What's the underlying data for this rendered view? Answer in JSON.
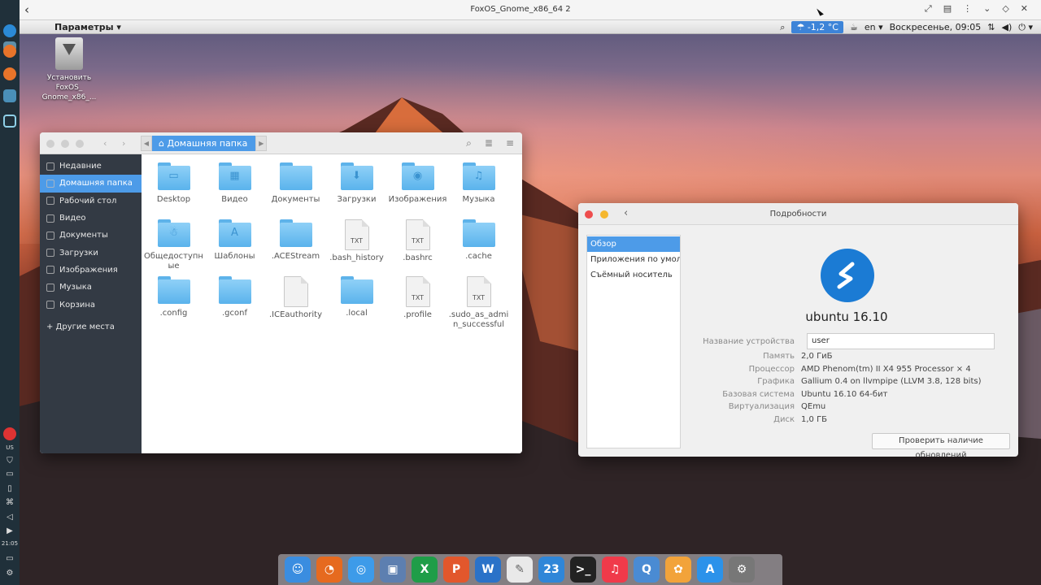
{
  "host": {
    "title": "FoxOS_Gnome_x86_64 2",
    "back_glyph": "‹",
    "icons": [
      "fullscreen-icon",
      "keyboard-icon",
      "more-icon",
      "chevron-down-icon",
      "diamond-icon",
      "close-icon"
    ]
  },
  "left_dock": {
    "lang": "US",
    "time": "21:05"
  },
  "top_panel": {
    "menu_label": "Параметры ▾",
    "weather": "☂ -1,2 °C",
    "lang": "en ▾",
    "clock": "Воскресенье, 09:05"
  },
  "desktop_icon": {
    "label": "Установить FoxOS_ Gnome_x86_..."
  },
  "files_window": {
    "breadcrumb": "Домашняя папка",
    "sidebar": [
      {
        "label": "Недавние",
        "icon": "clock-icon"
      },
      {
        "label": "Домашняя папка",
        "icon": "home-icon",
        "active": true
      },
      {
        "label": "Рабочий стол",
        "icon": "desktop-icon"
      },
      {
        "label": "Видео",
        "icon": "video-icon"
      },
      {
        "label": "Документы",
        "icon": "document-icon"
      },
      {
        "label": "Загрузки",
        "icon": "download-icon"
      },
      {
        "label": "Изображения",
        "icon": "image-icon"
      },
      {
        "label": "Музыка",
        "icon": "music-icon"
      },
      {
        "label": "Корзина",
        "icon": "trash-icon"
      }
    ],
    "other_places": "+ Другие места",
    "files": [
      {
        "name": "Desktop",
        "kind": "folder",
        "glyph": "▭"
      },
      {
        "name": "Видео",
        "kind": "folder",
        "glyph": "▦"
      },
      {
        "name": "Документы",
        "kind": "folder",
        "glyph": ""
      },
      {
        "name": "Загрузки",
        "kind": "folder",
        "glyph": "⬇"
      },
      {
        "name": "Изображения",
        "kind": "folder",
        "glyph": "◉"
      },
      {
        "name": "Музыка",
        "kind": "folder",
        "glyph": "♫"
      },
      {
        "name": "Общедоступные",
        "kind": "folder",
        "glyph": "☃"
      },
      {
        "name": "Шаблоны",
        "kind": "folder",
        "glyph": "A"
      },
      {
        "name": ".ACEStream",
        "kind": "folder",
        "glyph": ""
      },
      {
        "name": ".bash_history",
        "kind": "txt",
        "glyph": "TXT"
      },
      {
        "name": ".bashrc",
        "kind": "txt",
        "glyph": "TXT"
      },
      {
        "name": ".cache",
        "kind": "folder",
        "glyph": ""
      },
      {
        "name": ".config",
        "kind": "folder",
        "glyph": ""
      },
      {
        "name": ".gconf",
        "kind": "folder",
        "glyph": ""
      },
      {
        "name": ".ICEauthority",
        "kind": "doc",
        "glyph": ""
      },
      {
        "name": ".local",
        "kind": "folder",
        "glyph": ""
      },
      {
        "name": ".profile",
        "kind": "txt",
        "glyph": "TXT"
      },
      {
        "name": ".sudo_as_admin_successful",
        "kind": "txt",
        "glyph": "TXT"
      }
    ]
  },
  "details_window": {
    "title": "Подробности",
    "sidebar": [
      {
        "label": "Обзор",
        "active": true
      },
      {
        "label": "Приложения по умолчанию"
      },
      {
        "label": "Съёмный носитель"
      }
    ],
    "os_name": "ubuntu 16.10",
    "device_name_label": "Название устройства",
    "device_name_value": "user",
    "rows": [
      {
        "k": "Память",
        "v": "2,0 ГиБ"
      },
      {
        "k": "Процессор",
        "v": "AMD Phenom(tm) II X4 955 Processor × 4"
      },
      {
        "k": "Графика",
        "v": "Gallium 0.4 on llvmpipe (LLVM 3.8, 128 bits)"
      },
      {
        "k": "Базовая система",
        "v": "Ubuntu 16.10 64-бит"
      },
      {
        "k": "Виртуализация",
        "v": "QEmu"
      },
      {
        "k": "Диск",
        "v": "1,0 ГБ"
      }
    ],
    "update_button": "Проверить наличие обновлений"
  },
  "dock": {
    "apps": [
      {
        "name": "finder",
        "glyph": "☺",
        "color": "#3a8de0"
      },
      {
        "name": "firefox",
        "glyph": "◔",
        "color": "#e66a1f"
      },
      {
        "name": "browser",
        "glyph": "◎",
        "color": "#3d9be9"
      },
      {
        "name": "preview",
        "glyph": "▣",
        "color": "#5d7fb0"
      },
      {
        "name": "excel",
        "glyph": "X",
        "color": "#1f9d48"
      },
      {
        "name": "powerpoint",
        "glyph": "P",
        "color": "#e2572c"
      },
      {
        "name": "word",
        "glyph": "W",
        "color": "#2a72c8"
      },
      {
        "name": "notes",
        "glyph": "✎",
        "color": "#e9e9e9"
      },
      {
        "name": "calendar",
        "glyph": "23",
        "color": "#2f86d8"
      },
      {
        "name": "terminal",
        "glyph": ">_",
        "color": "#222"
      },
      {
        "name": "music",
        "glyph": "♫",
        "color": "#f03a4a"
      },
      {
        "name": "quicktime",
        "glyph": "Q",
        "color": "#4a8bd3"
      },
      {
        "name": "photos",
        "glyph": "✿",
        "color": "#f2a33a"
      },
      {
        "name": "app-store",
        "glyph": "A",
        "color": "#2b92ea"
      },
      {
        "name": "settings",
        "glyph": "⚙",
        "color": "#777"
      }
    ]
  }
}
